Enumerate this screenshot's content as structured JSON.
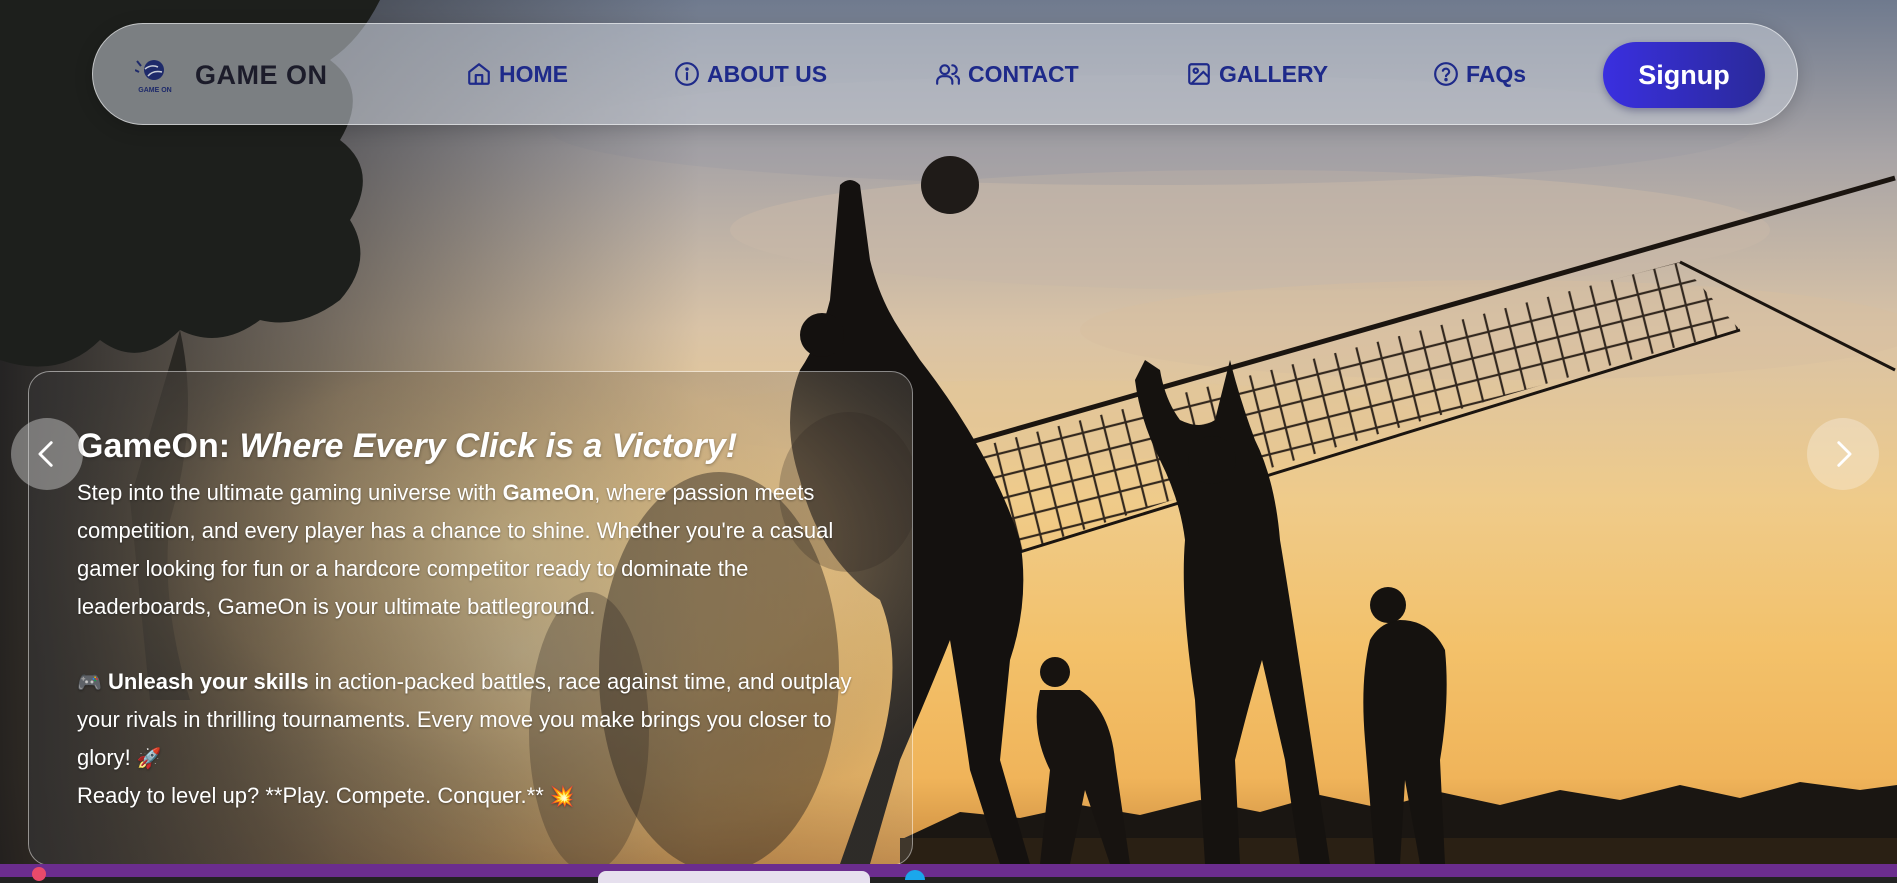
{
  "brand": {
    "name": "GAME ON",
    "logo_text": "GAME ON",
    "logo_icon": "volleyball-logo-icon"
  },
  "nav": {
    "items": [
      {
        "label": "HOME",
        "icon": "home-icon"
      },
      {
        "label": "ABOUT US",
        "icon": "info-icon"
      },
      {
        "label": "CONTACT",
        "icon": "users-icon"
      },
      {
        "label": "GALLERY",
        "icon": "image-icon"
      },
      {
        "label": "FAQs",
        "icon": "help-circle-icon"
      }
    ],
    "signup_label": "Signup"
  },
  "hero": {
    "title_plain": "GameOn: ",
    "title_italic": "Where Every Click is a Victory!",
    "p1_before": "Step into the ultimate gaming universe with ",
    "p1_bold": "GameOn",
    "p1_after": ", where passion meets competition, and every player has a chance to shine. Whether you're a casual gamer looking for fun or a hardcore competitor ready to dominate the leaderboards, GameOn is your ultimate battleground.",
    "p2_emoji": "🎮",
    "p2_bold": "Unleash your skills",
    "p2_after": " in action-packed battles, race against time, and outplay your rivals in thrilling tournaments. Every move you make brings you closer to glory! ",
    "p2_emoji_end": "🚀",
    "p3_text": "Ready to level up? **Play. Compete. Conquer.** ",
    "p3_emoji": "💥"
  },
  "carousel": {
    "prev_icon": "chevron-left-icon",
    "next_icon": "chevron-right-icon"
  },
  "colors": {
    "nav_text": "#1e2a8a",
    "signup_start": "#3a2fe0",
    "signup_end": "#2a2a9a",
    "taskbar": "#6b2d8e"
  }
}
